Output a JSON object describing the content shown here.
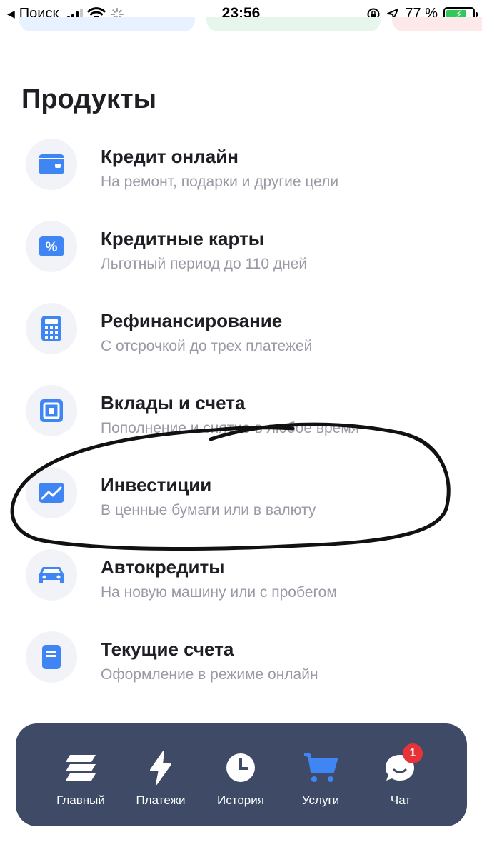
{
  "status_bar": {
    "back_label": "Поиск",
    "time": "23:56",
    "battery_percent": "77 %",
    "battery_level": 0.77
  },
  "section": {
    "title": "Продукты"
  },
  "products": [
    {
      "title": "Кредит онлайн",
      "subtitle": "На ремонт, подарки и другие цели",
      "icon": "wallet-icon"
    },
    {
      "title": "Кредитные карты",
      "subtitle": "Льготный период до 110 дней",
      "icon": "percent-card-icon"
    },
    {
      "title": "Рефинансирование",
      "subtitle": "С отсрочкой до трех платежей",
      "icon": "calculator-icon"
    },
    {
      "title": "Вклады и счета",
      "subtitle": "Пополнение и снятие в любое время",
      "icon": "safe-icon"
    },
    {
      "title": "Инвестиции",
      "subtitle": "В ценные бумаги или в валюту",
      "icon": "chart-up-icon"
    },
    {
      "title": "Автокредиты",
      "subtitle": "На новую машину или с пробегом",
      "icon": "car-icon"
    },
    {
      "title": "Текущие счета",
      "subtitle": "Оформление в режиме онлайн",
      "icon": "document-icon"
    }
  ],
  "tabbar": {
    "tabs": [
      {
        "label": "Главный",
        "icon": "stack-icon"
      },
      {
        "label": "Платежи",
        "icon": "lightning-icon"
      },
      {
        "label": "История",
        "icon": "clock-icon"
      },
      {
        "label": "Услуги",
        "icon": "cart-icon",
        "active": true
      },
      {
        "label": "Чат",
        "icon": "chat-icon",
        "badge": "1"
      }
    ]
  },
  "colors": {
    "accent": "#3f86f4",
    "tabbar_bg": "#3f4b66",
    "icon_circle": "#f1f3f8",
    "badge": "#e6333a"
  }
}
